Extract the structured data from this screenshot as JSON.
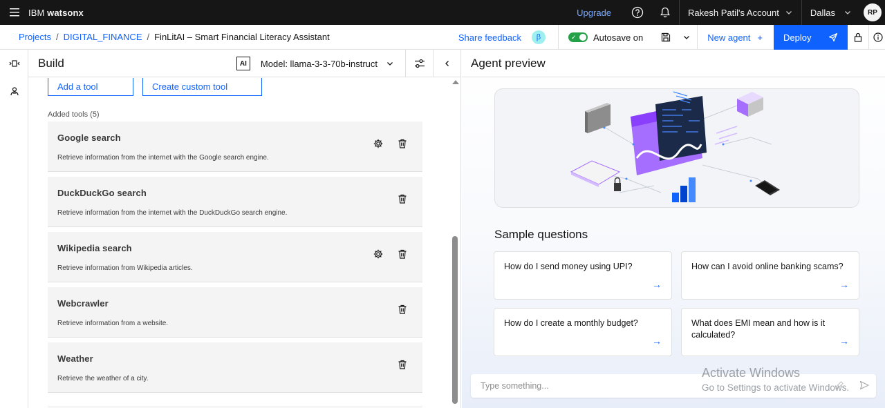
{
  "topbar": {
    "brand_prefix": "IBM",
    "brand_name": "watsonx",
    "upgrade": "Upgrade",
    "account": "Rakesh Patil's Account",
    "region": "Dallas",
    "avatar_initials": "RP"
  },
  "subbar": {
    "breadcrumb": [
      {
        "label": "Projects"
      },
      {
        "label": "DIGITAL_FINANCE"
      },
      {
        "label": "FinLitAI – Smart Financial Literacy Assistant"
      }
    ],
    "share_feedback": "Share feedback",
    "beta_badge": "β",
    "autosave_label": "Autosave on",
    "new_agent": "New agent",
    "new_agent_plus": "+",
    "deploy": "Deploy"
  },
  "build": {
    "title": "Build",
    "ai_badge": "AI",
    "model_label": "Model: llama-3-3-70b-instruct",
    "add_tool": "Add a tool",
    "create_custom_tool": "Create custom tool",
    "added_tools_label": "Added tools (5)",
    "tools": [
      {
        "name": "Google search",
        "description": "Retrieve information from the internet with the Google search engine.",
        "has_settings": true
      },
      {
        "name": "DuckDuckGo search",
        "description": "Retrieve information from the internet with the DuckDuckGo search engine.",
        "has_settings": false
      },
      {
        "name": "Wikipedia search",
        "description": "Retrieve information from Wikipedia articles.",
        "has_settings": true
      },
      {
        "name": "Webcrawler",
        "description": "Retrieve information from a website.",
        "has_settings": false
      },
      {
        "name": "Weather",
        "description": "Retrieve the weather of a city.",
        "has_settings": false
      }
    ]
  },
  "preview": {
    "title": "Agent preview",
    "sample_questions_title": "Sample questions",
    "questions": [
      "How do I send money using UPI?",
      "How can I avoid online banking scams?",
      "How do I create a monthly budget?",
      "What does EMI mean and how is it calculated?"
    ],
    "question_arrow": "→",
    "chat_placeholder": "Type something..."
  },
  "watermark": {
    "line1": "Activate Windows",
    "line2": "Go to Settings to activate Windows."
  },
  "colors": {
    "topbar_bg": "#161616",
    "link_blue": "#0f62fe",
    "upgrade_blue": "#78a9ff",
    "toggle_green": "#24a148",
    "tool_card_bg": "#f4f4f4"
  },
  "icons": [
    "menu-icon",
    "help-icon",
    "notification-icon",
    "chevron-down-icon",
    "save-icon",
    "send-icon",
    "lock-icon",
    "info-icon",
    "tools-icon",
    "agent-icon",
    "settings-sliders-icon",
    "chevron-left-icon",
    "gear-icon",
    "trash-icon",
    "arrow-right-icon",
    "edit-icon"
  ]
}
